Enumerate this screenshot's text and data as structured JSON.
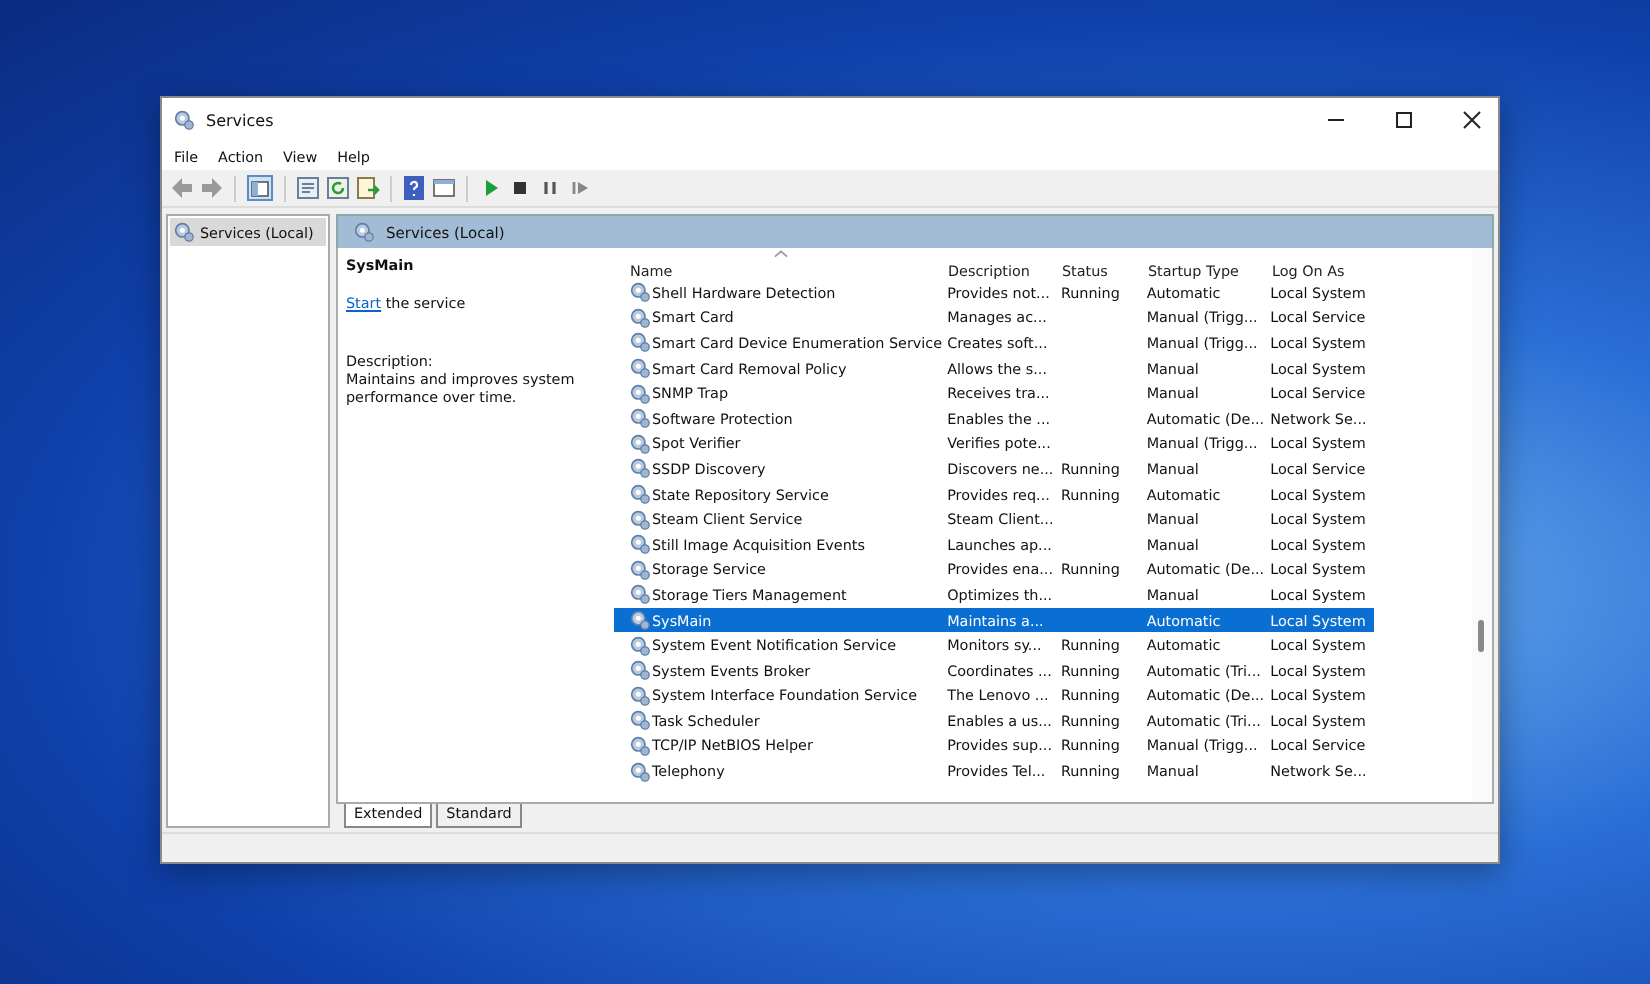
{
  "window": {
    "title": "Services"
  },
  "menu": [
    "File",
    "Action",
    "View",
    "Help"
  ],
  "toolbar": [
    {
      "kind": "back",
      "disabled": true
    },
    {
      "kind": "forward",
      "disabled": true
    },
    {
      "kind": "sep"
    },
    {
      "kind": "console",
      "selected": true
    },
    {
      "kind": "sep"
    },
    {
      "kind": "properties"
    },
    {
      "kind": "refresh"
    },
    {
      "kind": "export"
    },
    {
      "kind": "sep"
    },
    {
      "kind": "help"
    },
    {
      "kind": "view"
    },
    {
      "kind": "sep"
    },
    {
      "kind": "play"
    },
    {
      "kind": "stop"
    },
    {
      "kind": "pause"
    },
    {
      "kind": "resume"
    }
  ],
  "tree": [
    {
      "label": "Services (Local)",
      "selected": true
    }
  ],
  "header": "Services (Local)",
  "details": {
    "title": "SysMain",
    "link": "Start",
    "link_rest": " the service",
    "description_label": "Description:",
    "description": "Maintains and improves system performance over time."
  },
  "table": {
    "columns": [
      "Name",
      "Description",
      "Status",
      "Startup Type",
      "Log On As"
    ],
    "rows": [
      {
        "name": "Shell Hardware Detection",
        "description": "Provides not...",
        "status": "Running",
        "startup": "Automatic",
        "logon": "Local System",
        "selected": false
      },
      {
        "name": "Smart Card",
        "description": "Manages ac...",
        "status": "",
        "startup": "Manual (Trigg...",
        "logon": "Local Service",
        "selected": false
      },
      {
        "name": "Smart Card Device Enumeration Service",
        "description": "Creates soft...",
        "status": "",
        "startup": "Manual (Trigg...",
        "logon": "Local System",
        "selected": false
      },
      {
        "name": "Smart Card Removal Policy",
        "description": "Allows the s...",
        "status": "",
        "startup": "Manual",
        "logon": "Local System",
        "selected": false
      },
      {
        "name": "SNMP Trap",
        "description": "Receives tra...",
        "status": "",
        "startup": "Manual",
        "logon": "Local Service",
        "selected": false
      },
      {
        "name": "Software Protection",
        "description": "Enables the ...",
        "status": "",
        "startup": "Automatic (De...",
        "logon": "Network Se...",
        "selected": false
      },
      {
        "name": "Spot Verifier",
        "description": "Verifies pote...",
        "status": "",
        "startup": "Manual (Trigg...",
        "logon": "Local System",
        "selected": false
      },
      {
        "name": "SSDP Discovery",
        "description": "Discovers ne...",
        "status": "Running",
        "startup": "Manual",
        "logon": "Local Service",
        "selected": false
      },
      {
        "name": "State Repository Service",
        "description": "Provides req...",
        "status": "Running",
        "startup": "Automatic",
        "logon": "Local System",
        "selected": false
      },
      {
        "name": "Steam Client Service",
        "description": "Steam Client...",
        "status": "",
        "startup": "Manual",
        "logon": "Local System",
        "selected": false
      },
      {
        "name": "Still Image Acquisition Events",
        "description": "Launches ap...",
        "status": "",
        "startup": "Manual",
        "logon": "Local System",
        "selected": false
      },
      {
        "name": "Storage Service",
        "description": "Provides ena...",
        "status": "Running",
        "startup": "Automatic (De...",
        "logon": "Local System",
        "selected": false
      },
      {
        "name": "Storage Tiers Management",
        "description": "Optimizes th...",
        "status": "",
        "startup": "Manual",
        "logon": "Local System",
        "selected": false
      },
      {
        "name": "SysMain",
        "description": "Maintains a...",
        "status": "",
        "startup": "Automatic",
        "logon": "Local System",
        "selected": true
      },
      {
        "name": "System Event Notification Service",
        "description": "Monitors sy...",
        "status": "Running",
        "startup": "Automatic",
        "logon": "Local System",
        "selected": false
      },
      {
        "name": "System Events Broker",
        "description": "Coordinates ...",
        "status": "Running",
        "startup": "Automatic (Tri...",
        "logon": "Local System",
        "selected": false
      },
      {
        "name": "System Interface Foundation Service",
        "description": "The Lenovo ...",
        "status": "Running",
        "startup": "Automatic (De...",
        "logon": "Local System",
        "selected": false
      },
      {
        "name": "Task Scheduler",
        "description": "Enables a us...",
        "status": "Running",
        "startup": "Automatic (Tri...",
        "logon": "Local System",
        "selected": false
      },
      {
        "name": "TCP/IP NetBIOS Helper",
        "description": "Provides sup...",
        "status": "Running",
        "startup": "Manual (Trigg...",
        "logon": "Local Service",
        "selected": false
      },
      {
        "name": "Telephony",
        "description": "Provides Tel...",
        "status": "Running",
        "startup": "Manual",
        "logon": "Network Se...",
        "selected": false
      }
    ]
  },
  "view_tabs": [
    {
      "label": "Extended",
      "selected": true
    },
    {
      "label": "Standard",
      "selected": false
    }
  ]
}
